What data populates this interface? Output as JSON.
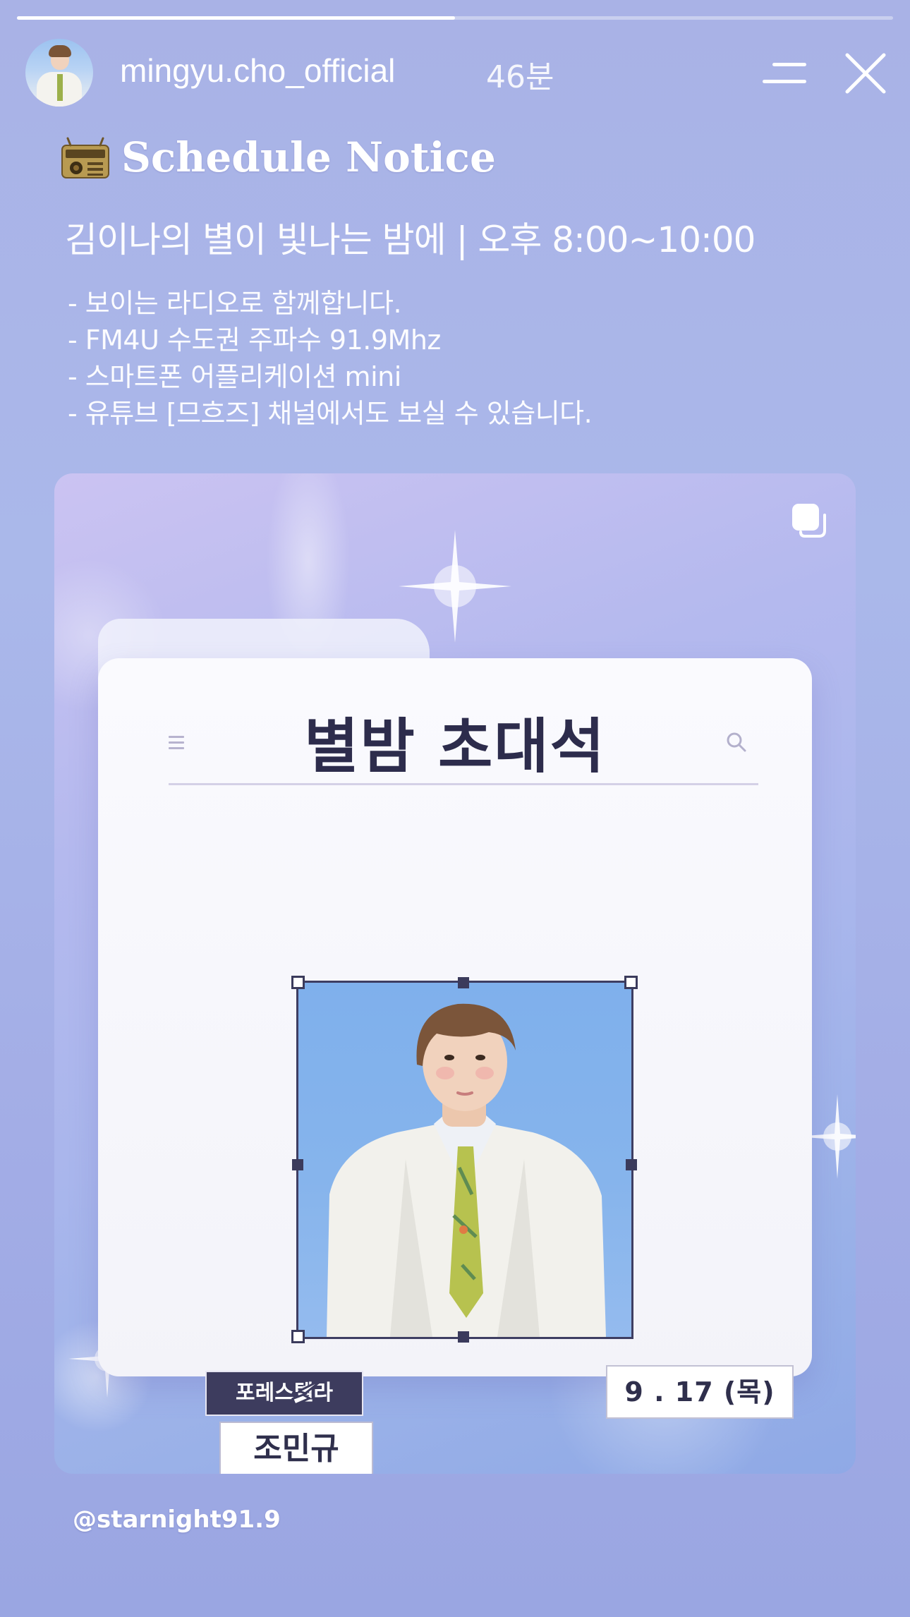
{
  "story": {
    "progress": 0.5,
    "username": "mingyu.cho_official",
    "time_ago": "46분",
    "icons": {
      "menu": "menu-icon",
      "close": "close-icon"
    }
  },
  "notice": {
    "title_icon": "radio-icon",
    "title": "Schedule Notice",
    "show_line": "김이나의 별이 빛나는 밤에  |  오후 8:00~10:00",
    "details": [
      "- 보이는 라디오로 함께합니다.",
      "- FM4U 수도권 주파수 91.9Mhz",
      "- 스마트폰 어플리케이션 mini",
      "- 유튜브 [므흐즈] 채널에서도 보실 수 있습니다."
    ]
  },
  "post": {
    "multi_icon": "multiple-posts-icon",
    "folder_title": "별밤 초대석",
    "group_label": "포레스텔라",
    "guest_name": "조민규",
    "date": "9 . 17 (목)"
  },
  "mention": "@starnight91.9",
  "colors": {
    "background": "#a9b2e6",
    "card_dark": "#3d3c5e",
    "photo_bg": "#86b4ec"
  }
}
